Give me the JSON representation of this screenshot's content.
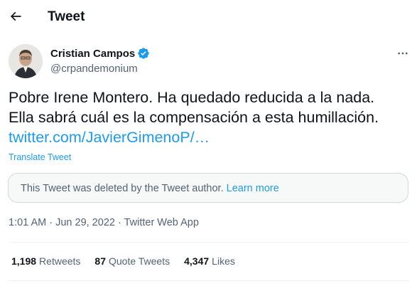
{
  "header": {
    "title": "Tweet"
  },
  "author": {
    "name": "Cristian Campos",
    "handle": "@crpandemonium",
    "verified_color": "#1d9bf0"
  },
  "tweet": {
    "line1": "Pobre Irene Montero. Ha quedado reducida a la nada.",
    "line2": "Ella sabrá cuál es la compensación a esta humillación.",
    "link": "twitter.com/JavierGimenoP/…",
    "translate_label": "Translate Tweet"
  },
  "deleted_notice": {
    "text": "This Tweet was deleted by the Tweet author.",
    "learn_more": "Learn more"
  },
  "meta": {
    "time": "1:01 AM",
    "date": "Jun 29, 2022",
    "source": "Twitter Web App",
    "separator": " · "
  },
  "stats": {
    "retweets_count": "1,198",
    "retweets_label": "Retweets",
    "quotes_count": "87",
    "quotes_label": "Quote Tweets",
    "likes_count": "4,347",
    "likes_label": "Likes"
  },
  "icons": {
    "back": "arrow-left-icon",
    "verified": "verified-badge-icon",
    "more": "more-horizontal-icon"
  }
}
